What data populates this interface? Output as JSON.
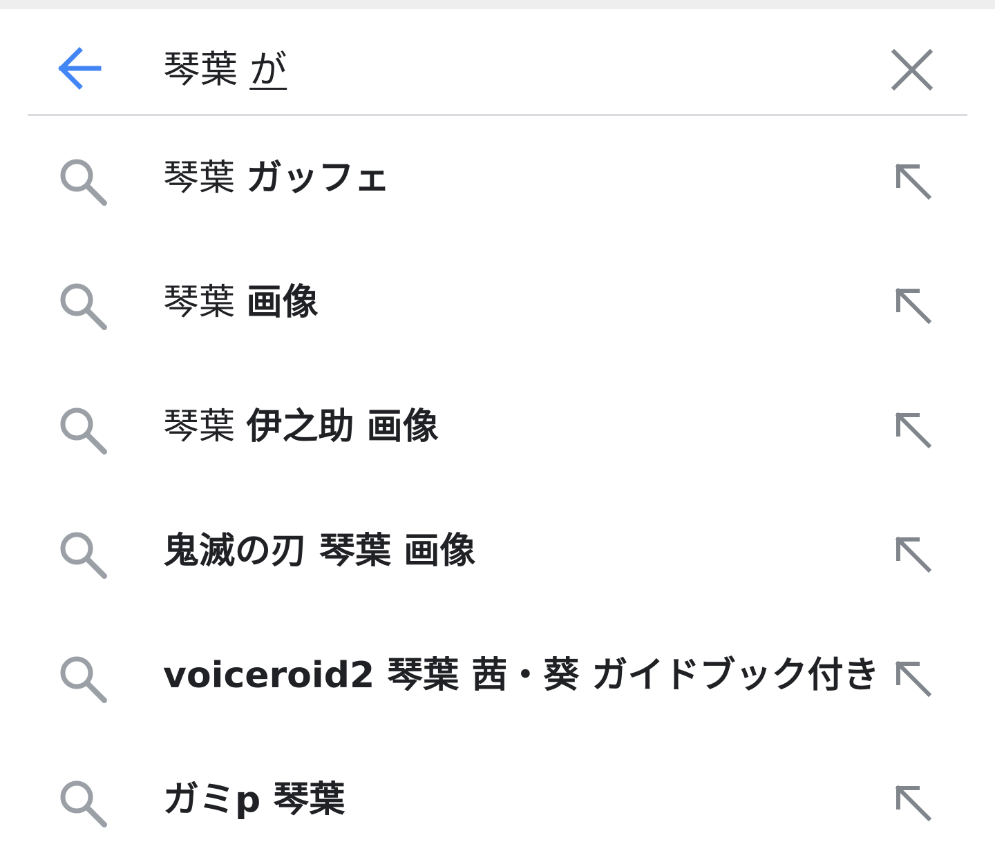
{
  "search": {
    "query_committed": "琴葉 ",
    "query_composing": "が"
  },
  "colors": {
    "accent": "#4285f4",
    "icon_gray": "#80868b",
    "text": "#202124",
    "divider": "#dadce0"
  },
  "suggestions": [
    {
      "query_part": "琴葉 ",
      "rest": "ガッフェ"
    },
    {
      "query_part": "琴葉 ",
      "rest": "画像"
    },
    {
      "query_part": "琴葉 ",
      "rest": "伊之助 画像"
    },
    {
      "query_part": "",
      "rest": "鬼滅の刃 琴葉 画像"
    },
    {
      "query_part": "",
      "rest": "voiceroid2 琴葉 茜・葵 ガイドブック付き"
    },
    {
      "query_part": "",
      "rest": "ガミp 琴葉"
    }
  ]
}
